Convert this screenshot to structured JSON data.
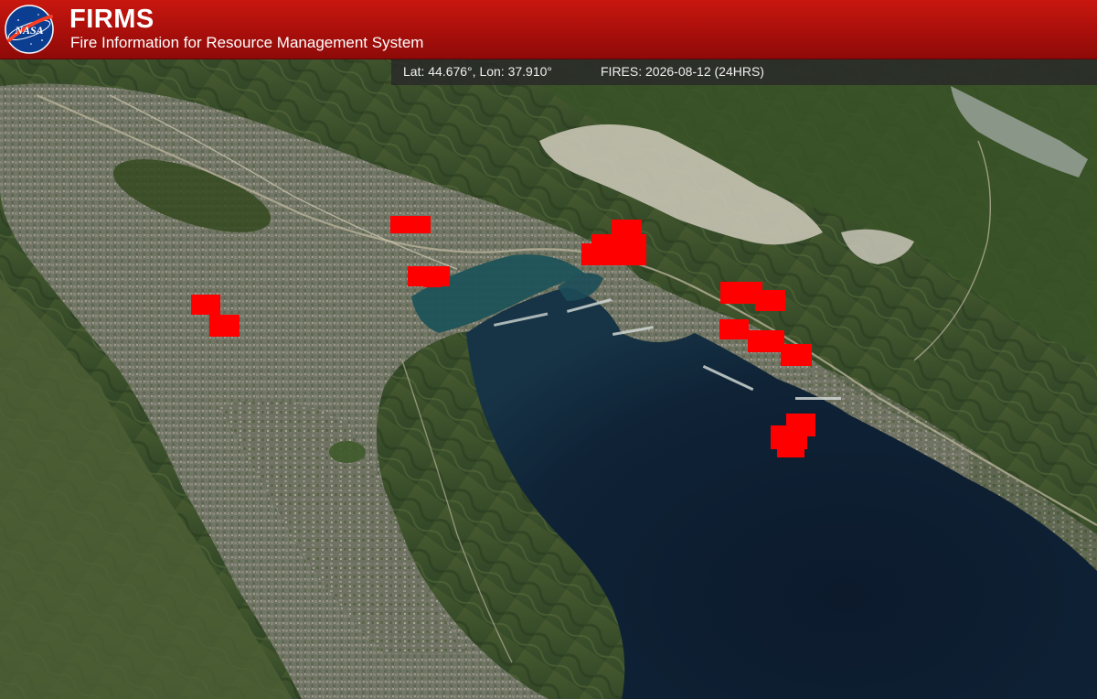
{
  "header": {
    "logo_text": "NASA",
    "title": "FIRMS",
    "subtitle": "Fire Information for Resource Management System"
  },
  "status": {
    "coordinates": "Lat: 44.676°, Lon: 37.910°",
    "fires": "FIRES: 2026-08-12 (24HRS)"
  },
  "colors": {
    "header_red": "#b0120c",
    "fire_red": "#ff0000",
    "sea_dark": "#0e1e30",
    "land_green": "#4a5a36"
  },
  "map": {
    "type": "satellite-imagery",
    "fire_pixel_count": 16
  }
}
